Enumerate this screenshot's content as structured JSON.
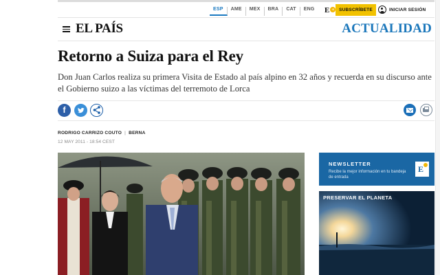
{
  "header": {
    "editions": [
      "ESP",
      "AME",
      "MEX",
      "BRA",
      "CAT",
      "ENG"
    ],
    "active_edition": "ESP",
    "e_logo": "E",
    "e_logo_plus": "+",
    "subscribe_label": "SUBSCRÍBETE",
    "login_label": "INICIAR SESIÓN"
  },
  "masthead": {
    "logo": "EL PAÍS",
    "section": "ACTUALIDAD"
  },
  "article": {
    "headline": "Retorno a Suiza para el Rey",
    "subhead": "Don Juan Carlos realiza su primera Visita de Estado al país alpino en 32 años y recuerda en su discurso ante el Gobierno suizo a las víctimas del terremoto de Lorca",
    "author": "RODRIGO CARRIZO COUTO",
    "byline_separator": "|",
    "location": "BERNA",
    "date": "12 MAY 2011 - 18:54 CEST"
  },
  "share": {
    "facebook_glyph": "f",
    "twitter_glyph": "t",
    "share_glyph": "<"
  },
  "sidebar": {
    "newsletter_title": "NEWSLETTER",
    "newsletter_text": "Recibe la mejor información en tu bandeja de entrada",
    "newsletter_icon_letter": "E",
    "planet_title": "PRESERVAR EL PLANETA"
  },
  "colors": {
    "brand_blue": "#1b77bb",
    "subscribe_yellow": "#f2c200",
    "facebook": "#2d5fa8",
    "twitter": "#3a8fd8",
    "newsletter_bg": "#1a67a4"
  }
}
